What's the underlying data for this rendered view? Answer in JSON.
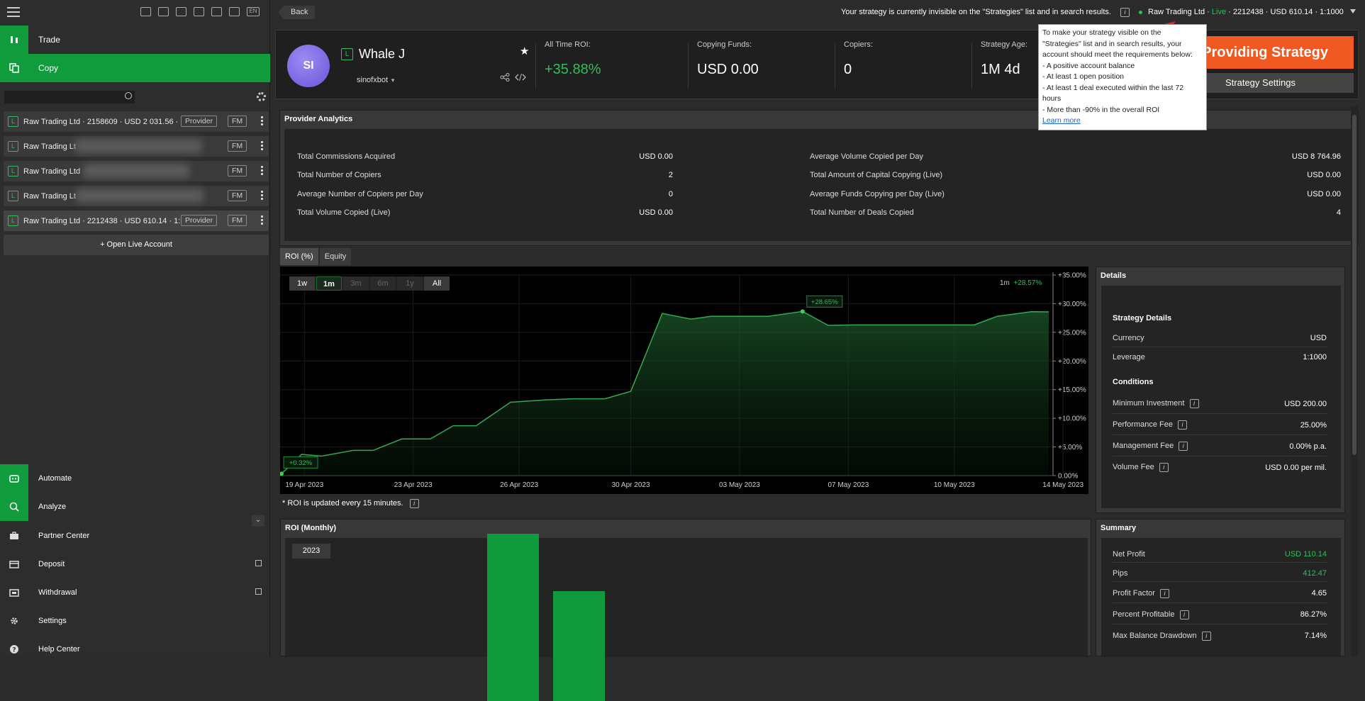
{
  "sidebar": {
    "nav": [
      {
        "label": "Trade",
        "icon": "trade-icon"
      },
      {
        "label": "Copy",
        "icon": "copy-icon"
      }
    ],
    "accounts": [
      {
        "text": "Raw Trading Ltd · 2158609 · USD 2 031.56 ·",
        "tag": "Provider",
        "fm": "FM"
      },
      {
        "text": "Raw Trading Lt",
        "tag": "",
        "fm": "FM"
      },
      {
        "text": "Raw Trading Ltd",
        "tag": "",
        "fm": "FM"
      },
      {
        "text": "Raw Trading Lt",
        "tag": "",
        "fm": "FM"
      },
      {
        "text": "Raw Trading Ltd · 2212438 · USD 610.14 · 1:",
        "tag": "Provider",
        "fm": "FM"
      }
    ],
    "open_live": "+ Open Live Account",
    "bottom": [
      {
        "label": "Automate",
        "icon": "automate-icon"
      },
      {
        "label": "Analyze",
        "icon": "analyze-icon"
      },
      {
        "label": "Partner Center",
        "icon": "partner-icon"
      },
      {
        "label": "Deposit",
        "icon": "deposit-icon"
      },
      {
        "label": "Withdrawal",
        "icon": "withdrawal-icon"
      },
      {
        "label": "Settings",
        "icon": "settings-icon"
      },
      {
        "label": "Help Center",
        "icon": "help-icon"
      }
    ],
    "lang": "EN"
  },
  "topbar": {
    "back": "Back",
    "notice": "Your strategy is currently invisible on the \"Strategies\" list and in search results.",
    "account_broker": "Raw Trading Ltd",
    "account_mode": "Live",
    "account_rest": "· 2212438 · USD 610.14 · 1:1000"
  },
  "strategy": {
    "avatar": "SI",
    "badge": "L",
    "name": "Whale J",
    "owner": "sinofxbot",
    "stats": [
      {
        "title": "All Time ROI:",
        "value": "+35.88%"
      },
      {
        "title": "Copying Funds:",
        "value": "USD 0.00"
      },
      {
        "title": "Copiers:",
        "value": "0"
      },
      {
        "title": "Strategy Age:",
        "value": "1M 4d"
      }
    ],
    "stop_label": "Stop Providing Strategy",
    "settings_label": "Strategy Settings"
  },
  "tooltip": {
    "lines": [
      "To make your strategy visible on the",
      "\"Strategies\" list and in search results, your",
      "account should meet the requirements below:",
      "- A positive account balance",
      "- At least 1 open position",
      "- At least 1 deal executed within the last 72",
      "hours",
      "- More than -90% in the overall ROI"
    ],
    "link": "Learn more"
  },
  "analytics": {
    "title": "Provider Analytics",
    "left": [
      {
        "k": "Total Commissions Acquired",
        "v": "USD 0.00"
      },
      {
        "k": "Total Number of Copiers",
        "v": "2"
      },
      {
        "k": "Average Number of Copiers per Day",
        "v": "0"
      },
      {
        "k": "Total Volume Copied (Live)",
        "v": "USD 0.00"
      }
    ],
    "right": [
      {
        "k": "Average Volume Copied per Day",
        "v": "USD 8 764.96"
      },
      {
        "k": "Total Amount of Capital Copying (Live)",
        "v": "USD 0.00"
      },
      {
        "k": "Average Funds Copying per Day (Live)",
        "v": "USD 0.00"
      },
      {
        "k": "Total Number of Deals Copied",
        "v": "4"
      }
    ]
  },
  "tabs": [
    "ROI (%)",
    "Equity"
  ],
  "ranges": [
    "1w",
    "1m",
    "3m",
    "6m",
    "1y",
    "All"
  ],
  "roi_note": "* ROI is updated every 15 minutes.",
  "chart_data": {
    "type": "area",
    "period_label": "1m",
    "period_value": "+28.57%",
    "x_ticks": [
      "19 Apr 2023",
      "23 Apr 2023",
      "26 Apr 2023",
      "30 Apr 2023",
      "03 May 2023",
      "07 May 2023",
      "10 May 2023",
      "14 May 2023"
    ],
    "y_ticks": [
      "+35.00%",
      "+30.00%",
      "+25.00%",
      "+20.00%",
      "+15.00%",
      "+10.00%",
      "+5.00%",
      "0.00%"
    ],
    "ylim": [
      0,
      35
    ],
    "x": [
      0,
      0.7,
      1.4,
      2.5,
      3.2,
      4.2,
      5.2,
      6.0,
      6.8,
      8.0,
      8.6,
      9.2,
      10.2,
      11.3,
      12.2,
      13.3,
      14.3,
      15.0,
      16.1,
      17.0,
      18.2,
      19.1,
      20.0,
      21.0,
      22.1,
      23.0,
      24.2,
      25.0,
      26.2,
      26.8
    ],
    "y": [
      0.32,
      3.7,
      3.4,
      4.4,
      4.4,
      6.4,
      6.4,
      8.7,
      8.7,
      12.8,
      13.0,
      13.2,
      13.4,
      13.4,
      14.7,
      28.3,
      27.3,
      27.8,
      27.8,
      27.8,
      28.65,
      26.2,
      26.3,
      26.3,
      26.3,
      26.3,
      26.3,
      27.8,
      28.6,
      28.57
    ],
    "start_label": "+0.32%",
    "peak_label": "+28.65%"
  },
  "details": {
    "title": "Details",
    "strategy_details": "Strategy Details",
    "currency_k": "Currency",
    "currency_v": "USD",
    "leverage_k": "Leverage",
    "leverage_v": "1:1000",
    "conditions": "Conditions",
    "rows": [
      {
        "k": "Minimum Investment",
        "v": "USD 200.00"
      },
      {
        "k": "Performance Fee",
        "v": "25.00%"
      },
      {
        "k": "Management Fee",
        "v": "0.00% p.a."
      },
      {
        "k": "Volume Fee",
        "v": "USD 0.00 per mil."
      }
    ]
  },
  "monthly": {
    "title": "ROI (Monthly)",
    "year": "2023",
    "values": [
      21.7,
      12.1
    ],
    "colors": {
      "bar": "#0f9b3d"
    }
  },
  "summary": {
    "title": "Summary",
    "rows": [
      {
        "k": "Net Profit",
        "v": "USD 110.14",
        "green": true
      },
      {
        "k": "Pips",
        "v": "412.47",
        "green": true
      },
      {
        "k": "Profit Factor",
        "v": "4.65",
        "green": false
      },
      {
        "k": "Percent Profitable",
        "v": "86.27%",
        "green": false
      },
      {
        "k": "Max Balance Drawdown",
        "v": "7.14%",
        "green": false
      }
    ]
  },
  "colors": {
    "accent": "#109b3c",
    "orange": "#f05a22",
    "positive": "#2fbf5a"
  }
}
